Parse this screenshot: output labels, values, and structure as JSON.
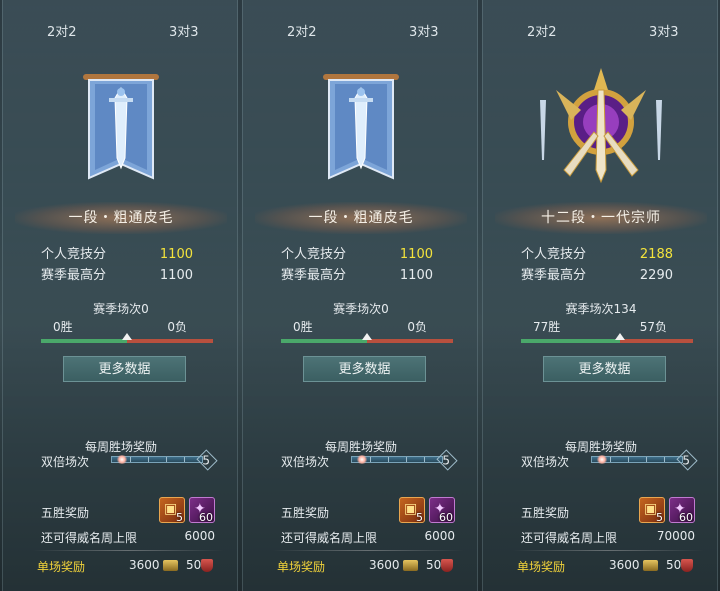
{
  "panels": [
    {
      "tabs": [
        "2对2",
        "3对3"
      ],
      "emblem": "banner-sword-icon",
      "rank": "一段・粗通皮毛",
      "score_label": "个人竞技分",
      "score": "1100",
      "best_label": "赛季最高分",
      "best": "1100",
      "season_label": "赛季场次0",
      "wins": "0胜",
      "losses": "0负",
      "win_ratio": 0.5,
      "more_label": "更多数据",
      "weekly_label": "每周胜场奖励",
      "double_label": "双倍场次",
      "double_max": "5",
      "five_label": "五胜奖励",
      "item1_count": "5",
      "item2_count": "60",
      "cap_label": "还可得威名周上限",
      "cap_value": "6000",
      "single_label": "单场奖励",
      "single_value1": "3600",
      "single_value2": "50"
    },
    {
      "tabs": [
        "2对2",
        "3对3"
      ],
      "emblem": "banner-sword-icon",
      "rank": "一段・粗通皮毛",
      "score_label": "个人竞技分",
      "score": "1100",
      "best_label": "赛季最高分",
      "best": "1100",
      "season_label": "赛季场次0",
      "wins": "0胜",
      "losses": "0负",
      "win_ratio": 0.5,
      "more_label": "更多数据",
      "weekly_label": "每周胜场奖励",
      "double_label": "双倍场次",
      "double_max": "5",
      "five_label": "五胜奖励",
      "item1_count": "5",
      "item2_count": "60",
      "cap_label": "还可得威名周上限",
      "cap_value": "6000",
      "single_label": "单场奖励",
      "single_value1": "3600",
      "single_value2": "50"
    },
    {
      "tabs": [
        "2对2",
        "3对3"
      ],
      "emblem": "golden-crest-icon",
      "rank": "十二段・一代宗师",
      "score_label": "个人竞技分",
      "score": "2188",
      "best_label": "赛季最高分",
      "best": "2290",
      "season_label": "赛季场次134",
      "wins": "77胜",
      "losses": "57负",
      "win_ratio": 0.575,
      "more_label": "更多数据",
      "weekly_label": "每周胜场奖励",
      "double_label": "双倍场次",
      "double_max": "5",
      "five_label": "五胜奖励",
      "item1_count": "5",
      "item2_count": "60",
      "cap_label": "还可得威名周上限",
      "cap_value": "70000",
      "single_label": "单场奖励",
      "single_value1": "3600",
      "single_value2": "50"
    }
  ]
}
